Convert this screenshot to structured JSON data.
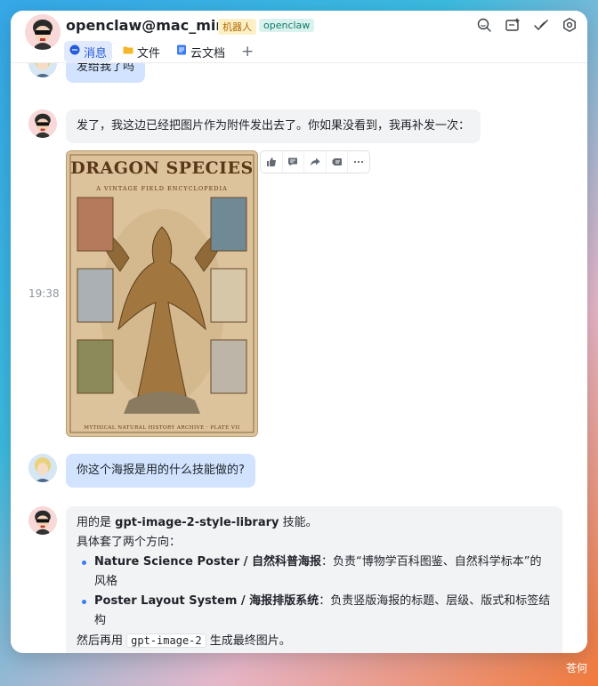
{
  "header": {
    "title": "openclaw@mac_mini",
    "badge_bot": "机器人",
    "badge_tag": "openclaw",
    "tabs": [
      {
        "label": "消息",
        "icon": "chat-bubble-icon",
        "active": true
      },
      {
        "label": "文件",
        "icon": "folder-icon",
        "active": false
      },
      {
        "label": "云文档",
        "icon": "doc-icon",
        "active": false
      }
    ],
    "add_tab": "+",
    "icons": [
      "search-icon",
      "new-window-icon",
      "check-icon",
      "settings-icon"
    ]
  },
  "messages": {
    "partial": {
      "text": "发给我了吗"
    },
    "reply1": {
      "text": "发了，我这边已经把图片作为附件发出去了。你如果没看到，我再补发一次："
    },
    "timestamp": "19:38",
    "image": {
      "title": "DRAGON SPECIES",
      "subtitle": "A VINTAGE FIELD ENCYCLOPEDIA",
      "footer": "MYTHICAL NATURAL HISTORY ARCHIVE · PLATE VII"
    },
    "toolbar_icons": [
      "thumbs-up-icon",
      "comment-icon",
      "forward-icon",
      "pin-icon",
      "more-icon"
    ],
    "user_q": {
      "text": "你这个海报是用的什么技能做的?"
    },
    "answer": {
      "line1_prefix": "用的是 ",
      "skill": "gpt-image-2-style-library",
      "line1_suffix": " 技能。",
      "line2": "具体套了两个方向：",
      "points": [
        {
          "bold": "Nature Science Poster / 自然科普海报",
          "rest": "：负责“博物学百科图鉴、自然科学标本”的风格"
        },
        {
          "bold": "Poster Layout System / 海报排版系统",
          "rest": "：负责竖版海报的标题、层级、版式和标签结构"
        }
      ],
      "line3_prefix": "然后再用 ",
      "code": "gpt-image-2",
      "line3_suffix": " 生成最终图片。"
    }
  },
  "watermark": "苍何",
  "colors": {
    "accent": "#245bdb",
    "bubble_gray": "#f2f3f5",
    "bubble_blue": "#d1e3fe",
    "bullet": "#3c7cf2"
  }
}
